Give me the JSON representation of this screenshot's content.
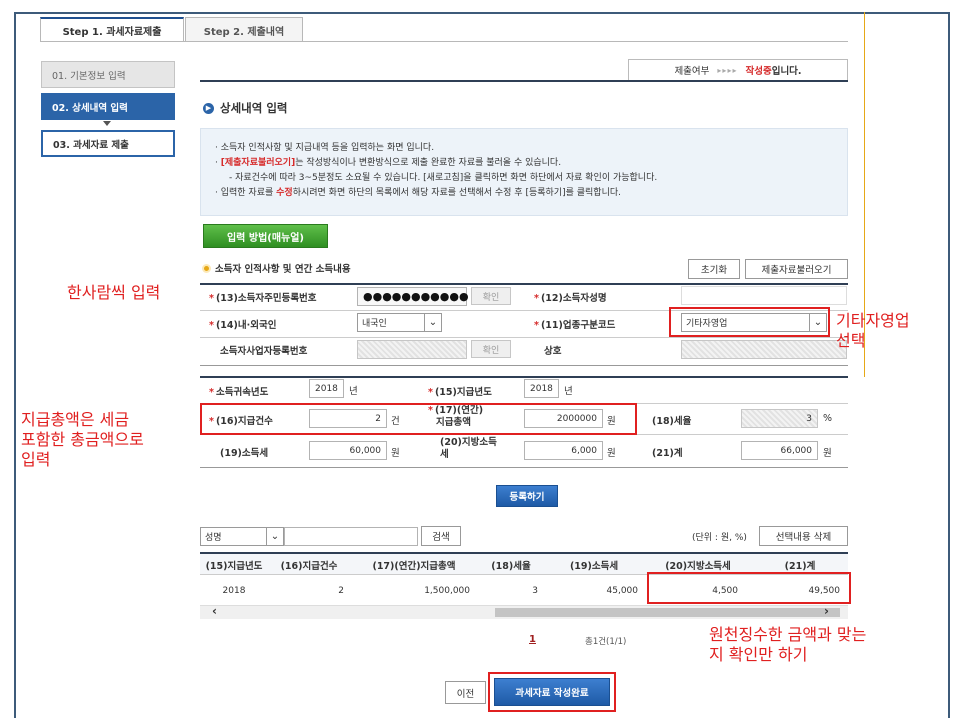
{
  "tabs": [
    {
      "label": "Step 1. 과세자료제출"
    },
    {
      "label": "Step 2. 제출내역"
    }
  ],
  "steps": [
    {
      "label": "01. 기본정보 입력"
    },
    {
      "label": "02. 상세내역 입력"
    },
    {
      "label": "03. 과세자료 제출"
    }
  ],
  "status": {
    "label": "제출여부",
    "arrows": "▸▸▸▸",
    "value": "작성중",
    "suffix": "입니다."
  },
  "section_title": "상세내역 입력",
  "info": {
    "line1": "소득자 인적사항 및 지급내역 등을 입력하는 화면 입니다.",
    "line2_red": "[제출자료불러오기]",
    "line2_rest": "는 작성방식이나 변환방식으로 제출 완료한 자료를 불러올 수 있습니다.",
    "line3": "- 자료건수에 따라 3~5분정도 소요될 수 있습니다. [새로고침]을 클릭하면 화면 하단에서 자료 확인이 가능합니다.",
    "line4_a": "입력한 자료를 ",
    "line4_red": "수정",
    "line4_b": "하시려면 화면 하단의 목록에서 해당 자료를 선택해서 수정 후 [등록하기]를 클릭합니다."
  },
  "manual_button": "입력 방법(매뉴얼)",
  "form_title": "소득자 인적사항 및 연간 소득내용",
  "reset_button": "초기화",
  "load_button": "제출자료불러오기",
  "form": {
    "rrn_label": "(13)소득자주민등록번호",
    "rrn_value": "●●●●●●●●●●●",
    "confirm": "확인",
    "name_label": "(12)소득자성명",
    "nation_label": "(14)내·외국인",
    "nation_value": "내국인",
    "biz_label": "(11)업종구분코드",
    "biz_value": "기타자영업",
    "bizno_label": "소득자사업자등록번호",
    "trade_label": "상호",
    "attr_year_label": "소득귀속년도",
    "attr_year": "2018",
    "year_unit": "년",
    "pay_year_label": "(15)지급년도",
    "pay_year": "2018",
    "count_label": "(16)지급건수",
    "count": "2",
    "count_unit": "건",
    "total_label_1": "(17)(연간)",
    "total_label_2": "지급총액",
    "total": "2000000",
    "won": "원",
    "rate_label": "(18)세율",
    "rate": "3",
    "pct": "%",
    "income_tax_label": "(19)소득세",
    "income_tax": "60,000",
    "local_tax_label_1": "(20)지방소득",
    "local_tax_label_2": "세",
    "local_tax": "6,000",
    "sum_label": "(21)계",
    "sum": "66,000"
  },
  "register_button": "등록하기",
  "search": {
    "select": "성명",
    "button": "검색",
    "unit_note": "(단위 : 원, %)",
    "delete_button": "선택내용 삭제"
  },
  "table": {
    "headers": [
      "(15)지급년도",
      "(16)지급건수",
      "(17)(연간)지급총액",
      "(18)세율",
      "(19)소득세",
      "(20)지방소득세",
      "(21)계"
    ],
    "rows": [
      [
        "2018",
        "2",
        "1,500,000",
        "3",
        "45,000",
        "4,500",
        "49,500"
      ]
    ]
  },
  "pager": {
    "page": "1",
    "info": "총1건(1/1)"
  },
  "bottom": {
    "prev": "이전",
    "complete": "과세자료 작성완료"
  },
  "annotations": {
    "one_person": "한사람씩 입력",
    "biz_select_1": "기타자영업",
    "biz_select_2": "선택",
    "total_note_1": "지급총액은 세금",
    "total_note_2": "포함한 총금액으로",
    "total_note_3": "입력",
    "check_note_1": "원천징수한 금액과 맞는",
    "check_note_2": "지 확인만 하기"
  },
  "colors": {
    "annotation": "#e02020",
    "primary": "#2b64a8",
    "accent": "#d62b2b",
    "green": "#3fa42f"
  }
}
